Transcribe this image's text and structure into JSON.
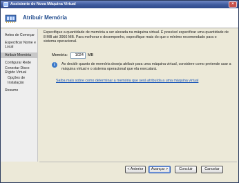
{
  "window": {
    "title": "Assistente de Nova Máquina Virtual",
    "close_symbol": "×"
  },
  "header": {
    "title": "Atribuir Memória",
    "icon": "memory-chip-icon"
  },
  "sidebar": {
    "items": [
      {
        "label": "Antes de Começar",
        "active": false
      },
      {
        "label": "Especificar Nome e Local",
        "active": false
      },
      {
        "label": "Atribuir Memória",
        "active": true
      },
      {
        "label": "Configurar Rede",
        "active": false
      },
      {
        "label": "Conectar Disco Rígido Virtual",
        "active": false
      },
      {
        "label": "Opções de Instalação",
        "active": false
      },
      {
        "label": "Resumo",
        "active": false
      }
    ]
  },
  "main": {
    "description": "Especifique a quantidade de memória a ser alocada na máquina virtual. É possível especificar uma quantidade de 8 MB até 3966 MB. Para melhorar o desempenho, especifique mais do que o mínimo recomendado para o sistema operacional.",
    "memory_label": "Memória:",
    "memory_value": "1024",
    "memory_unit": "MB",
    "info_text": "Ao decidir quanto de memória deseja atribuir para uma máquina virtual, considere como pretende usar a máquina virtual e o sistema operacional que ela executará.",
    "info_symbol": "i",
    "link": "Saiba mais sobre como determinar a memória que será atribuída a uma máquina virtual"
  },
  "buttons": {
    "back": "< Anterior",
    "next": "Avançar >",
    "finish": "Concluir",
    "cancel": "Cancelar"
  },
  "colors": {
    "title_bar": "#3e5a9d",
    "header_title": "#1f4a8c",
    "link": "#1a56b8",
    "active_nav": "#c7c7c7"
  }
}
